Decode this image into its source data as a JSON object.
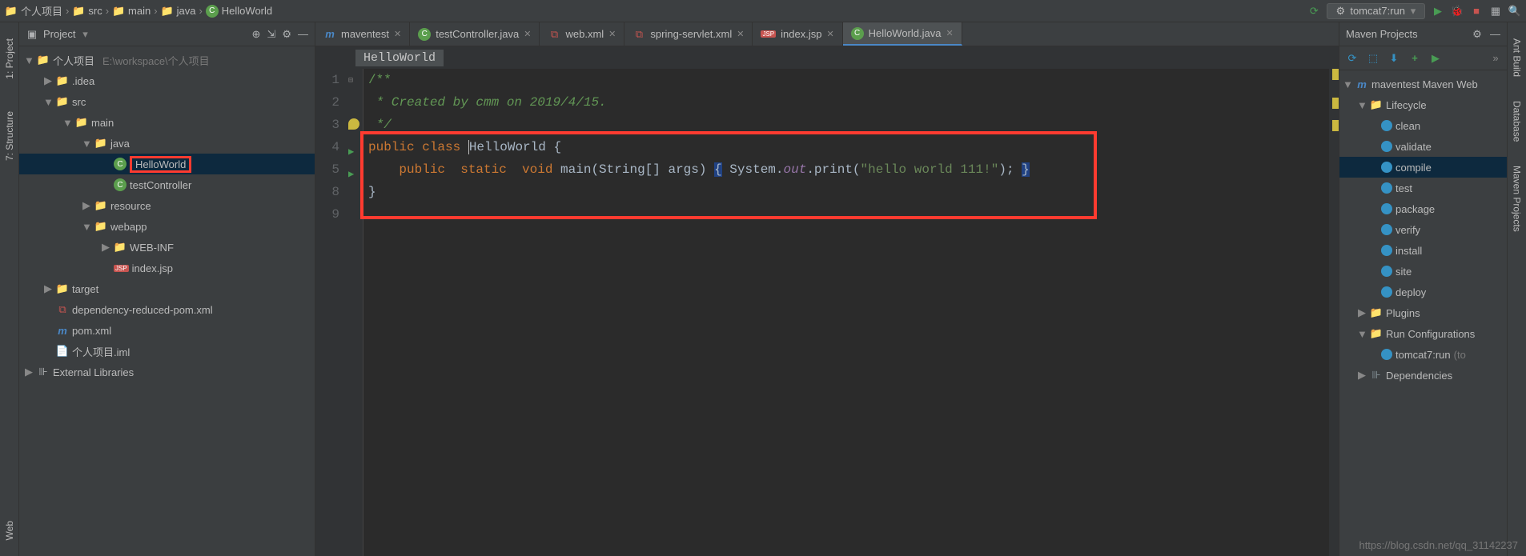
{
  "breadcrumbs": [
    "个人项目",
    "src",
    "main",
    "java",
    "HelloWorld"
  ],
  "run_config": "tomcat7:run",
  "left_rail": [
    "1: Project",
    "7: Structure",
    "Web"
  ],
  "right_rail": [
    "Ant Build",
    "Database",
    "Maven Projects"
  ],
  "project_panel": {
    "title": "Project",
    "root": {
      "name": "个人项目",
      "path": "E:\\workspace\\个人项目"
    },
    "tree": [
      {
        "depth": 1,
        "icon": "folder",
        "label": ".idea",
        "chev": "▶"
      },
      {
        "depth": 1,
        "icon": "folder-src",
        "label": "src",
        "chev": "▼"
      },
      {
        "depth": 2,
        "icon": "folder",
        "label": "main",
        "chev": "▼"
      },
      {
        "depth": 3,
        "icon": "folder-src",
        "label": "java",
        "chev": "▼"
      },
      {
        "depth": 4,
        "icon": "class",
        "label": "HelloWorld",
        "selected": true,
        "redbox": true
      },
      {
        "depth": 4,
        "icon": "class",
        "label": "testController"
      },
      {
        "depth": 3,
        "icon": "folder",
        "label": "resource",
        "chev": "▶"
      },
      {
        "depth": 3,
        "icon": "folder",
        "label": "webapp",
        "chev": "▼"
      },
      {
        "depth": 4,
        "icon": "folder",
        "label": "WEB-INF",
        "chev": "▶"
      },
      {
        "depth": 4,
        "icon": "jsp",
        "label": "index.jsp"
      },
      {
        "depth": 1,
        "icon": "folder-target",
        "label": "target",
        "chev": "▶"
      },
      {
        "depth": 1,
        "icon": "xml",
        "label": "dependency-reduced-pom.xml"
      },
      {
        "depth": 1,
        "icon": "m",
        "label": "pom.xml"
      },
      {
        "depth": 1,
        "icon": "file",
        "label": "个人项目.iml"
      }
    ],
    "external": "External Libraries"
  },
  "tabs": [
    {
      "icon": "m",
      "label": "maventest"
    },
    {
      "icon": "class",
      "label": "testController.java"
    },
    {
      "icon": "xml",
      "label": "web.xml"
    },
    {
      "icon": "xml",
      "label": "spring-servlet.xml"
    },
    {
      "icon": "jsp",
      "label": "index.jsp"
    },
    {
      "icon": "class",
      "label": "HelloWorld.java",
      "active": true
    }
  ],
  "editor_crumb": "HelloWorld",
  "code": {
    "lines": [
      {
        "n": 1,
        "html": "<span class='comstar'>/**</span>"
      },
      {
        "n": 2,
        "html": "<span class='com'> * Created by cmm on 2019/4/15.</span>"
      },
      {
        "n": 3,
        "html": "<span class='com'> */</span>"
      },
      {
        "n": 4,
        "html": "<span class='kw'>public class </span><span class='cls cursor-line'>HelloWorld</span><span class='plain'> {</span>"
      },
      {
        "n": 5,
        "html": "    <span class='kw'>public  static  void </span><span class='fn'>main</span><span class='plain'>(String[] args) </span><span class='plain hl-box'>{</span><span class='plain'> System.</span><span class='flditalic'>out</span><span class='plain'>.print(</span><span class='str'>\"hello world 111!\"</span><span class='plain'>); </span><span class='plain hl-box'>}</span>"
      },
      {
        "n": 8,
        "html": "<span class='plain'>}</span>"
      },
      {
        "n": 9,
        "html": ""
      }
    ]
  },
  "maven": {
    "title": "Maven Projects",
    "root": "maventest Maven Web",
    "lifecycle_label": "Lifecycle",
    "lifecycle": [
      "clean",
      "validate",
      "compile",
      "test",
      "package",
      "verify",
      "install",
      "site",
      "deploy"
    ],
    "lifecycle_selected": "compile",
    "plugins": "Plugins",
    "run_configs": "Run Configurations",
    "run_item": "tomcat7:run",
    "run_hint": "(to",
    "dependencies": "Dependencies"
  },
  "watermark": "https://blog.csdn.net/qq_31142237"
}
